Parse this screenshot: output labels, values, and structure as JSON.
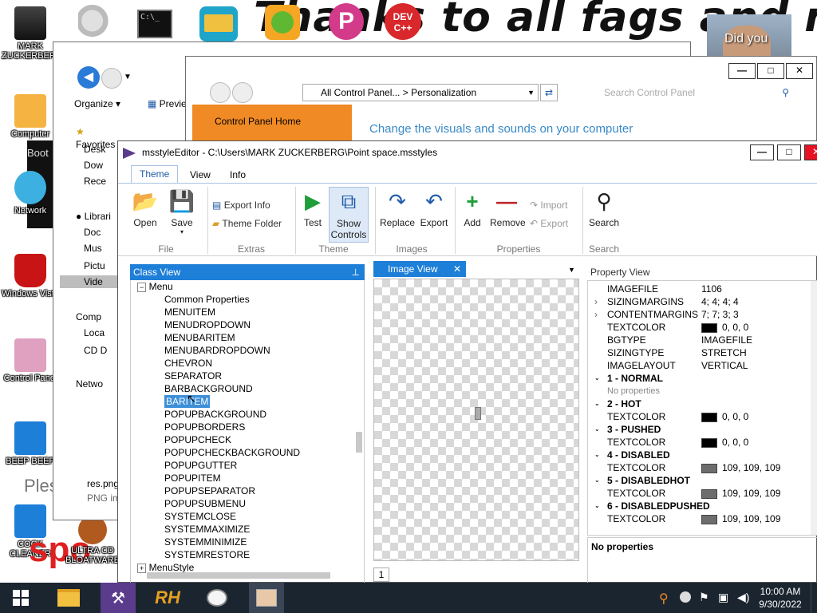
{
  "desktop": {
    "banner": "Thanks to all fags and niggers",
    "overlay_text": "Did you",
    "icons": [
      {
        "label": "MARK ZUCKERBERG"
      },
      {
        "label": "Computer"
      },
      {
        "label": "Network"
      },
      {
        "label": "Windows Vista"
      },
      {
        "label": "Control Panel"
      },
      {
        "label": "BEEP BEEP"
      },
      {
        "label": "COCK CLEANER"
      },
      {
        "label": "ULTRA CD BLOATWARE"
      }
    ],
    "bg_side_text": "Boot",
    "bg_ples": "Ples",
    "bg_spo": "spo",
    "dev_icon_text": "DEV C++"
  },
  "explorer": {
    "organize": "Organize",
    "preview": "Previe",
    "nav": {
      "favorites": "Favorites",
      "items": [
        "Desk",
        "Dow",
        "Rece"
      ],
      "libraries": "Librari",
      "lib_items": [
        "Doc",
        "Mus",
        "Pictu",
        "Vide"
      ],
      "computer": "Comp",
      "comp_items": [
        "Loca",
        "CD D"
      ],
      "network": "Netwo"
    },
    "file_name": "res.png",
    "file_type": "PNG im"
  },
  "control_panel": {
    "breadcrumb_1": "All Control Panel...",
    "breadcrumb_sep": ">",
    "breadcrumb_2": "Personalization",
    "search_placeholder": "Search Control Panel",
    "home_link": "Control Panel Home",
    "heading": "Change the visuals and sounds on your computer"
  },
  "ms": {
    "title": "msstyleEditor - C:\\Users\\MARK ZUCKERBERG\\Point space.msstyles",
    "tabs": [
      "Theme",
      "View",
      "Info"
    ],
    "ribbon": {
      "open": "Open",
      "save": "Save",
      "file_group": "File",
      "export_info": "Export Info",
      "theme_folder": "Theme Folder",
      "extras_group": "Extras",
      "test": "Test",
      "show_controls": "Show Controls",
      "theme_group": "Theme",
      "replace": "Replace",
      "export": "Export",
      "images_group": "Images",
      "add": "Add",
      "remove": "Remove",
      "import": "Import",
      "export_small": "Export",
      "properties_group": "Properties",
      "search": "Search",
      "search_group": "Search"
    },
    "class_view": {
      "title": "Class View",
      "parent": "Menu",
      "items": [
        "Common Properties",
        "MENUITEM",
        "MENUDROPDOWN",
        "MENUBARITEM",
        "MENUBARDROPDOWN",
        "CHEVRON",
        "SEPARATOR",
        "BARBACKGROUND",
        "BARITEM",
        "POPUPBACKGROUND",
        "POPUPBORDERS",
        "POPUPCHECK",
        "POPUPCHECKBACKGROUND",
        "POPUPGUTTER",
        "POPUPITEM",
        "POPUPSEPARATOR",
        "POPUPSUBMENU",
        "SYSTEMCLOSE",
        "SYSTEMMAXIMIZE",
        "SYSTEMMINIMIZE",
        "SYSTEMRESTORE"
      ],
      "selected": "BARITEM",
      "next_parent": "MenuStyle"
    },
    "image_view": {
      "tab": "Image View",
      "page": "1"
    },
    "property_view": {
      "title": "Property View",
      "rows": [
        {
          "type": "prop",
          "name": "IMAGEFILE",
          "value": "1106"
        },
        {
          "type": "prop",
          "name": "SIZINGMARGINS",
          "value": "4; 4; 4; 4",
          "expand": true
        },
        {
          "type": "prop",
          "name": "CONTENTMARGINS",
          "value": "7; 7; 3; 3",
          "expand": true
        },
        {
          "type": "color",
          "name": "TEXTCOLOR",
          "value": "0, 0, 0",
          "color": "#000000"
        },
        {
          "type": "prop",
          "name": "BGTYPE",
          "value": "IMAGEFILE"
        },
        {
          "type": "prop",
          "name": "SIZINGTYPE",
          "value": "STRETCH"
        },
        {
          "type": "prop",
          "name": "IMAGELAYOUT",
          "value": "VERTICAL"
        },
        {
          "type": "group",
          "name": "1 - NORMAL"
        },
        {
          "type": "none",
          "name": "No properties"
        },
        {
          "type": "group",
          "name": "2 - HOT"
        },
        {
          "type": "color",
          "name": "TEXTCOLOR",
          "value": "0, 0, 0",
          "color": "#000000"
        },
        {
          "type": "group",
          "name": "3 - PUSHED"
        },
        {
          "type": "color",
          "name": "TEXTCOLOR",
          "value": "0, 0, 0",
          "color": "#000000"
        },
        {
          "type": "group",
          "name": "4 - DISABLED"
        },
        {
          "type": "color",
          "name": "TEXTCOLOR",
          "value": "109, 109, 109",
          "color": "#6d6d6d"
        },
        {
          "type": "group",
          "name": "5 - DISABLEDHOT"
        },
        {
          "type": "color",
          "name": "TEXTCOLOR",
          "value": "109, 109, 109",
          "color": "#6d6d6d"
        },
        {
          "type": "group",
          "name": "6 - DISABLEDPUSHED"
        },
        {
          "type": "color",
          "name": "TEXTCOLOR",
          "value": "109, 109, 109",
          "color": "#6d6d6d"
        }
      ],
      "description": "No properties"
    }
  },
  "taskbar": {
    "time": "10:00 AM",
    "date": "9/30/2022",
    "rh_label": "RH"
  },
  "colors": {
    "accent": "#1e7fd8",
    "taskbar": "#1b2530",
    "cp_orange": "#f08a24"
  }
}
